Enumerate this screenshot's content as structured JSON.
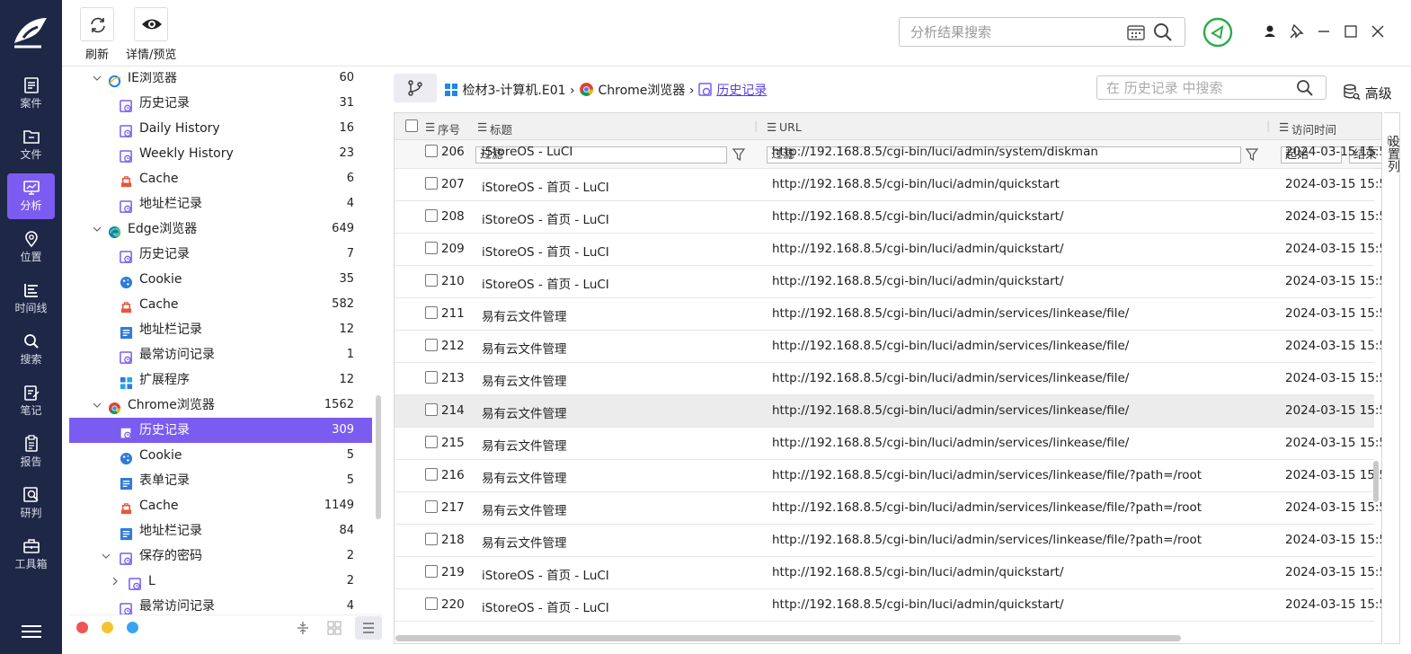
{
  "colors": {
    "nav_bg": "#1e2746",
    "accent": "#7b5cf0"
  },
  "nav": [
    {
      "label": "案件",
      "icon": "case-icon"
    },
    {
      "label": "文件",
      "icon": "folder-icon"
    },
    {
      "label": "分析",
      "icon": "analysis-icon",
      "active": true
    },
    {
      "label": "位置",
      "icon": "location-pin-icon"
    },
    {
      "label": "时间线",
      "icon": "timeline-icon"
    },
    {
      "label": "搜索",
      "icon": "search-icon"
    },
    {
      "label": "笔记",
      "icon": "note-icon"
    },
    {
      "label": "报告",
      "icon": "report-icon"
    },
    {
      "label": "研判",
      "icon": "research-icon"
    },
    {
      "label": "工具箱",
      "icon": "toolbox-icon"
    }
  ],
  "toolbar": {
    "refresh_label": "刷新",
    "details_label": "详情/预览"
  },
  "search": {
    "placeholder": "分析结果搜索"
  },
  "tree": [
    {
      "label": "IE浏览器",
      "count": "60",
      "lvl": 0,
      "icon": "ie"
    },
    {
      "label": "历史记录",
      "count": "31",
      "lvl": 1,
      "icon": "hist"
    },
    {
      "label": "Daily History",
      "count": "16",
      "lvl": 1,
      "icon": "hist"
    },
    {
      "label": "Weekly History",
      "count": "23",
      "lvl": 1,
      "icon": "hist"
    },
    {
      "label": "Cache",
      "count": "6",
      "lvl": 1,
      "icon": "cache"
    },
    {
      "label": "地址栏记录",
      "count": "4",
      "lvl": 1,
      "icon": "hist"
    },
    {
      "label": "Edge浏览器",
      "count": "649",
      "lvl": 0,
      "icon": "edge"
    },
    {
      "label": "历史记录",
      "count": "7",
      "lvl": 1,
      "icon": "hist"
    },
    {
      "label": "Cookie",
      "count": "35",
      "lvl": 1,
      "icon": "cookie"
    },
    {
      "label": "Cache",
      "count": "582",
      "lvl": 1,
      "icon": "cache"
    },
    {
      "label": "地址栏记录",
      "count": "12",
      "lvl": 1,
      "icon": "addr"
    },
    {
      "label": "最常访问记录",
      "count": "1",
      "lvl": 1,
      "icon": "hist"
    },
    {
      "label": "扩展程序",
      "count": "12",
      "lvl": 1,
      "icon": "ext"
    },
    {
      "label": "Chrome浏览器",
      "count": "1562",
      "lvl": 0,
      "icon": "chrome"
    },
    {
      "label": "历史记录",
      "count": "309",
      "lvl": 1,
      "icon": "hist",
      "sel": true
    },
    {
      "label": "Cookie",
      "count": "5",
      "lvl": 1,
      "icon": "cookie"
    },
    {
      "label": "表单记录",
      "count": "5",
      "lvl": 1,
      "icon": "addr"
    },
    {
      "label": "Cache",
      "count": "1149",
      "lvl": 1,
      "icon": "cache"
    },
    {
      "label": "地址栏记录",
      "count": "84",
      "lvl": 1,
      "icon": "addr"
    },
    {
      "label": "保存的密码",
      "count": "2",
      "lvl": 1,
      "icon": "hist",
      "expand": true
    },
    {
      "label": "L",
      "count": "2",
      "lvl": 2,
      "icon": "hist",
      "collapsed": true
    },
    {
      "label": "最常访问记录",
      "count": "4",
      "lvl": 1,
      "icon": "hist"
    }
  ],
  "breadcrumb": {
    "device": "检材3-计算机.E01",
    "browser": "Chrome浏览器",
    "current": "历史记录"
  },
  "table_search": {
    "placeholder": "在 历史记录 中搜索"
  },
  "advanced_label": "高级",
  "columns": {
    "seq": "序号",
    "title": "标题",
    "url": "URL",
    "time": "访问时间"
  },
  "filters": {
    "title": "过滤",
    "url": "过滤",
    "start": "起始",
    "end": "结束"
  },
  "settings_col": "设置列",
  "rows": [
    {
      "seq": "206",
      "title": "iStoreOS - LuCI",
      "url": "http://192.168.8.5/cgi-bin/luci/admin/system/diskman",
      "time": "2024-03-15 15:5"
    },
    {
      "seq": "207",
      "title": "iStoreOS - 首页 - LuCI",
      "url": "http://192.168.8.5/cgi-bin/luci/admin/quickstart",
      "time": "2024-03-15 15:5"
    },
    {
      "seq": "208",
      "title": "iStoreOS - 首页 - LuCI",
      "url": "http://192.168.8.5/cgi-bin/luci/admin/quickstart/",
      "time": "2024-03-15 15:5"
    },
    {
      "seq": "209",
      "title": "iStoreOS - 首页 - LuCI",
      "url": "http://192.168.8.5/cgi-bin/luci/admin/quickstart/",
      "time": "2024-03-15 15:5"
    },
    {
      "seq": "210",
      "title": "iStoreOS - 首页 - LuCI",
      "url": "http://192.168.8.5/cgi-bin/luci/admin/quickstart/",
      "time": "2024-03-15 15:5"
    },
    {
      "seq": "211",
      "title": "易有云文件管理",
      "url": "http://192.168.8.5/cgi-bin/luci/admin/services/linkease/file/",
      "time": "2024-03-15 15:5"
    },
    {
      "seq": "212",
      "title": "易有云文件管理",
      "url": "http://192.168.8.5/cgi-bin/luci/admin/services/linkease/file/",
      "time": "2024-03-15 15:5"
    },
    {
      "seq": "213",
      "title": "易有云文件管理",
      "url": "http://192.168.8.5/cgi-bin/luci/admin/services/linkease/file/",
      "time": "2024-03-15 15:5"
    },
    {
      "seq": "214",
      "title": "易有云文件管理",
      "url": "http://192.168.8.5/cgi-bin/luci/admin/services/linkease/file/",
      "time": "2024-03-15 15:5",
      "hl": true
    },
    {
      "seq": "215",
      "title": "易有云文件管理",
      "url": "http://192.168.8.5/cgi-bin/luci/admin/services/linkease/file/",
      "time": "2024-03-15 15:5"
    },
    {
      "seq": "216",
      "title": "易有云文件管理",
      "url": "http://192.168.8.5/cgi-bin/luci/admin/services/linkease/file/?path=/root",
      "time": "2024-03-15 15:5"
    },
    {
      "seq": "217",
      "title": "易有云文件管理",
      "url": "http://192.168.8.5/cgi-bin/luci/admin/services/linkease/file/?path=/root",
      "time": "2024-03-15 15:5"
    },
    {
      "seq": "218",
      "title": "易有云文件管理",
      "url": "http://192.168.8.5/cgi-bin/luci/admin/services/linkease/file/?path=/root",
      "time": "2024-03-15 15:5"
    },
    {
      "seq": "219",
      "title": "iStoreOS - 首页 - LuCI",
      "url": "http://192.168.8.5/cgi-bin/luci/admin/quickstart/",
      "time": "2024-03-15 15:5"
    },
    {
      "seq": "220",
      "title": "iStoreOS - 首页 - LuCI",
      "url": "http://192.168.8.5/cgi-bin/luci/admin/quickstart/",
      "time": "2024-03-15 15:5"
    }
  ]
}
